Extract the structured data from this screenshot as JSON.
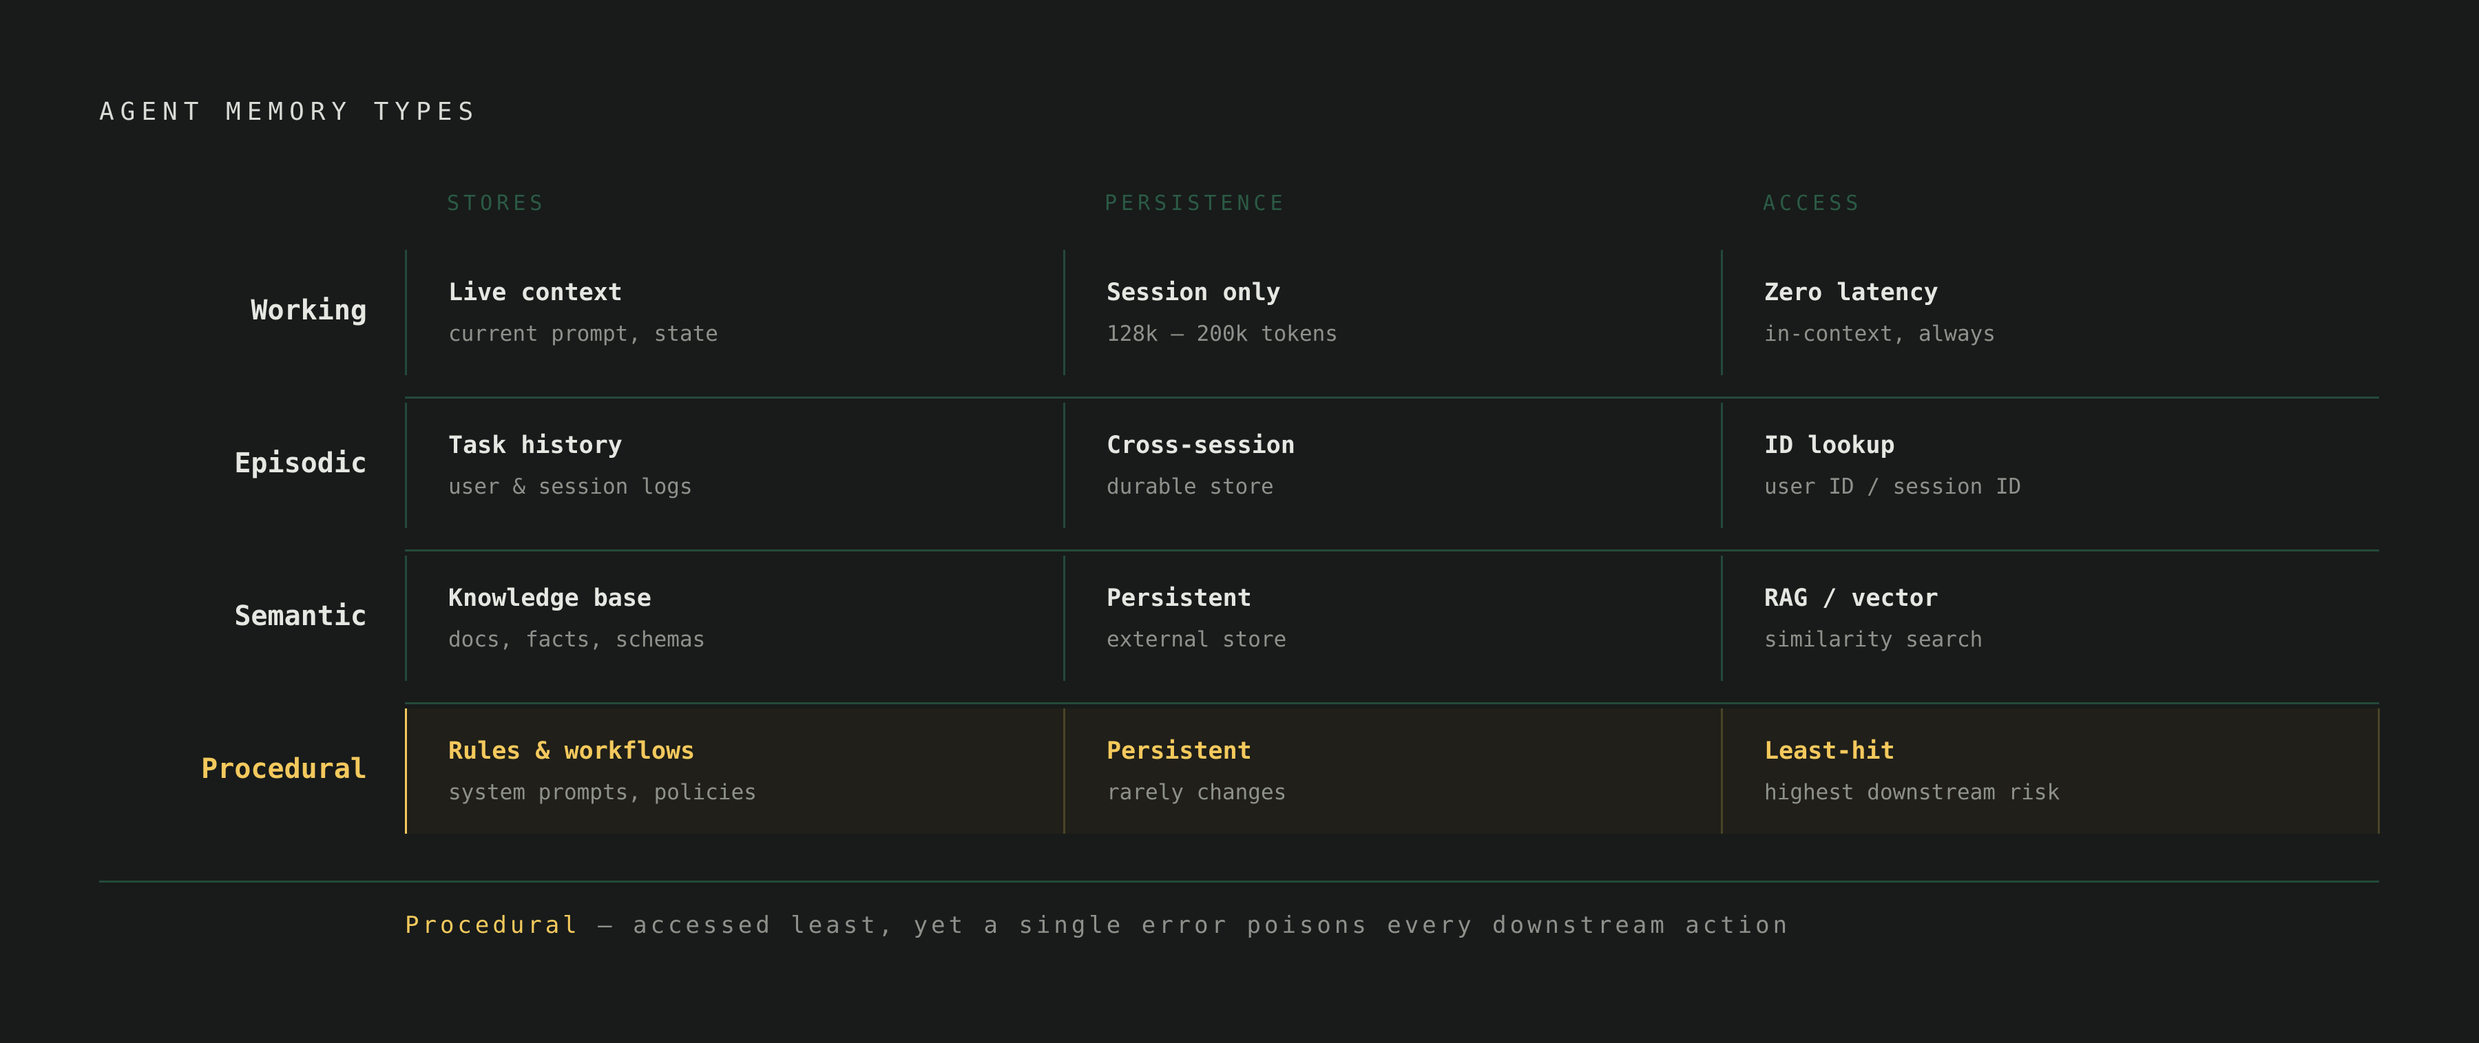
{
  "title": "AGENT MEMORY TYPES",
  "columns": [
    "STORES",
    "PERSISTENCE",
    "ACCESS"
  ],
  "rows": [
    {
      "label": "Working",
      "highlighted": false,
      "cells": [
        {
          "primary": "Live context",
          "secondary": "current prompt, state"
        },
        {
          "primary": "Session only",
          "secondary": "128k – 200k tokens"
        },
        {
          "primary": "Zero latency",
          "secondary": "in-context, always"
        }
      ]
    },
    {
      "label": "Episodic",
      "highlighted": false,
      "cells": [
        {
          "primary": "Task history",
          "secondary": "user & session logs"
        },
        {
          "primary": "Cross-session",
          "secondary": "durable store"
        },
        {
          "primary": "ID lookup",
          "secondary": "user ID / session ID"
        }
      ]
    },
    {
      "label": "Semantic",
      "highlighted": false,
      "cells": [
        {
          "primary": "Knowledge base",
          "secondary": "docs, facts, schemas"
        },
        {
          "primary": "Persistent",
          "secondary": "external store"
        },
        {
          "primary": "RAG / vector",
          "secondary": "similarity search"
        }
      ]
    },
    {
      "label": "Procedural",
      "highlighted": true,
      "cells": [
        {
          "primary": "Rules & workflows",
          "secondary": "system prompts, policies"
        },
        {
          "primary": "Persistent",
          "secondary": "rarely changes"
        },
        {
          "primary": "Least-hit",
          "secondary": "highest downstream risk"
        }
      ]
    }
  ],
  "footnote": {
    "emphasis": "Procedural",
    "text": " — accessed least, yet a single error poisons every downstream action"
  },
  "colors": {
    "background": "#181b1a",
    "grid_line": "#24493a",
    "column_header": "#2b5a45",
    "accent": "#f4c95d",
    "primary_text": "#e6e7e2",
    "secondary_text": "#8e918b"
  }
}
